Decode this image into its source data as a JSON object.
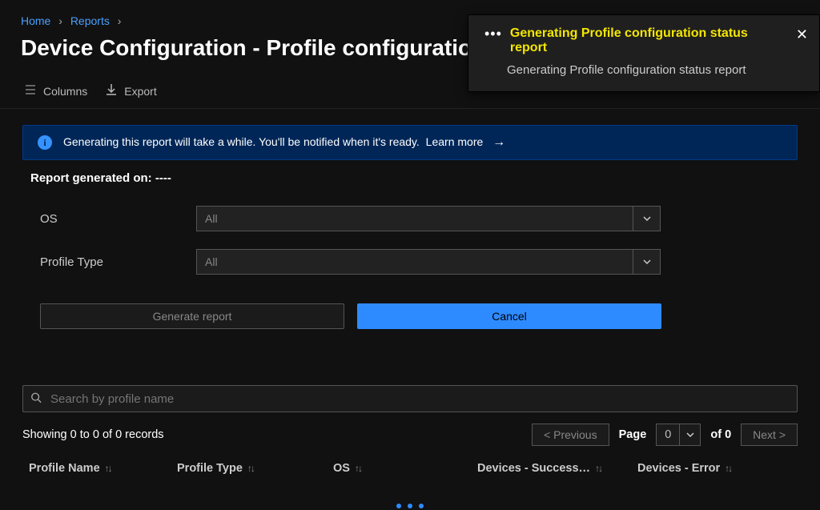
{
  "breadcrumb": {
    "items": [
      "Home",
      "Reports"
    ]
  },
  "page_title": "Device Configuration - Profile configuration status",
  "toolbar": {
    "columns_label": "Columns",
    "export_label": "Export"
  },
  "banner": {
    "text": "Generating this report will take a while. You'll be notified when it's ready.",
    "learn_more": "Learn more"
  },
  "report_generated": {
    "label": "Report generated on:",
    "value": "----"
  },
  "filters": {
    "os": {
      "label": "OS",
      "selected": "All"
    },
    "profile_type": {
      "label": "Profile Type",
      "selected": "All"
    }
  },
  "actions": {
    "generate": "Generate report",
    "cancel": "Cancel"
  },
  "search": {
    "placeholder": "Search by profile name"
  },
  "records": {
    "summary": "Showing 0 to 0 of 0 records"
  },
  "pagination": {
    "prev": "<  Previous",
    "page_label": "Page",
    "page_value": "0",
    "of_label": "of 0",
    "next": "Next  >"
  },
  "columns": [
    "Profile Name",
    "Profile Type",
    "OS",
    "Devices - Success…",
    "Devices - Error"
  ],
  "toast": {
    "title": "Generating Profile configuration status report",
    "body": "Generating Profile configuration status report"
  }
}
